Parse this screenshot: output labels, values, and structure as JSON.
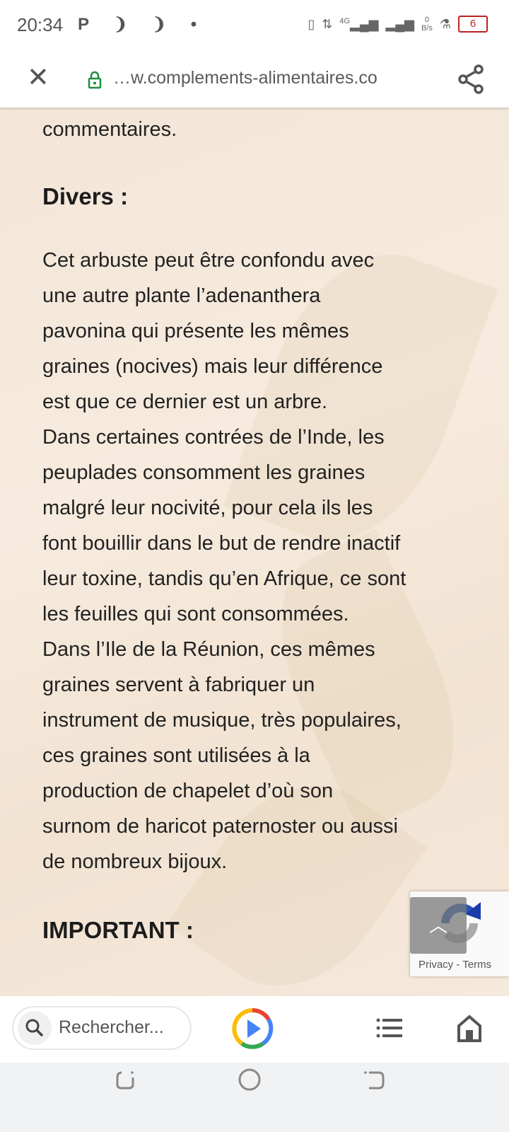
{
  "status_bar": {
    "time": "20:34",
    "network": "4G",
    "speed_value": "0",
    "speed_unit": "B/s",
    "battery": "6"
  },
  "url_bar": {
    "url": "…w.complements-alimentaires.co"
  },
  "article": {
    "lines_top": [
      "commentaires."
    ],
    "heading_divers": "Divers :",
    "paragraph_lines": [
      "Cet arbuste peut être confondu avec",
      "une autre plante l’adenanthera",
      "pavonina qui présente les mêmes",
      "graines (nocives) mais leur différence",
      "est que ce dernier est un arbre.",
      "Dans certaines contrées de l’Inde, les",
      "peuplades consomment les graines",
      "malgré leur nocivité, pour cela ils les",
      "font bouillir dans le but de rendre inactif",
      "leur toxine, tandis qu’en Afrique, ce sont",
      "les feuilles qui sont consommées.",
      "Dans l’Ile de la Réunion, ces mêmes",
      "graines servent à fabriquer un",
      "instrument de musique, très populaires,",
      "ces graines sont utilisées à la",
      "production de chapelet d’où son",
      "surnom de haricot paternoster ou aussi",
      "de nombreux bijoux."
    ],
    "heading_important": "IMPORTANT :"
  },
  "recaptcha": {
    "label": "Privacy - Terms"
  },
  "bottom_bar": {
    "search_placeholder": "Rechercher..."
  }
}
